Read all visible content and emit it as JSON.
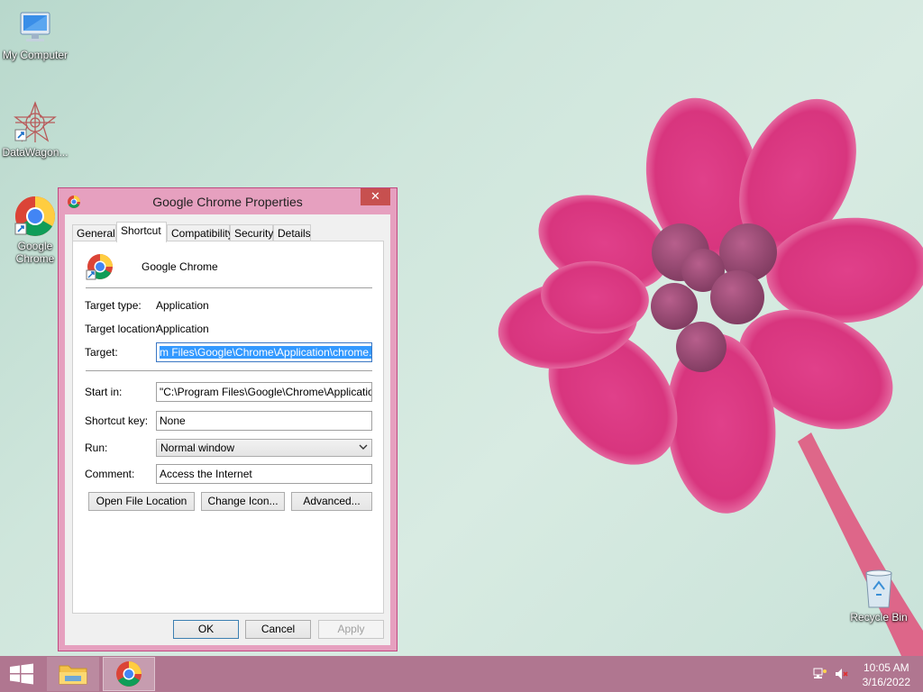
{
  "desktop": {
    "icons": [
      {
        "label": "My Computer"
      },
      {
        "label": "DataWagon..."
      },
      {
        "label_line1": "Google",
        "label_line2": "Chrome"
      },
      {
        "label": "Recycle Bin"
      }
    ]
  },
  "dialog": {
    "title": "Google Chrome Properties",
    "close_glyph": "✕",
    "tabs": [
      "General",
      "Shortcut",
      "Compatibility",
      "Security",
      "Details"
    ],
    "active_tab": "Shortcut",
    "app_name": "Google Chrome",
    "fields": {
      "target_type_label": "Target type:",
      "target_type_value": "Application",
      "target_location_label": "Target location:",
      "target_location_value": "Application",
      "target_label": "Target:",
      "target_value": "m Files\\Google\\Chrome\\Application\\chrome.exe\"",
      "start_in_label": "Start in:",
      "start_in_value": "\"C:\\Program Files\\Google\\Chrome\\Application\"",
      "shortcut_key_label": "Shortcut key:",
      "shortcut_key_value": "None",
      "run_label": "Run:",
      "run_value": "Normal window",
      "comment_label": "Comment:",
      "comment_value": "Access the Internet"
    },
    "buttons": {
      "open_file_location": "Open File Location",
      "change_icon": "Change Icon...",
      "advanced": "Advanced...",
      "ok": "OK",
      "cancel": "Cancel",
      "apply": "Apply"
    }
  },
  "taskbar": {
    "clock_time": "10:05 AM",
    "clock_date": "3/16/2022"
  },
  "colors": {
    "window_frame": "#e6a0bf",
    "taskbar": "#b07690",
    "close_button": "#c7504f",
    "selection": "#3399ff"
  }
}
